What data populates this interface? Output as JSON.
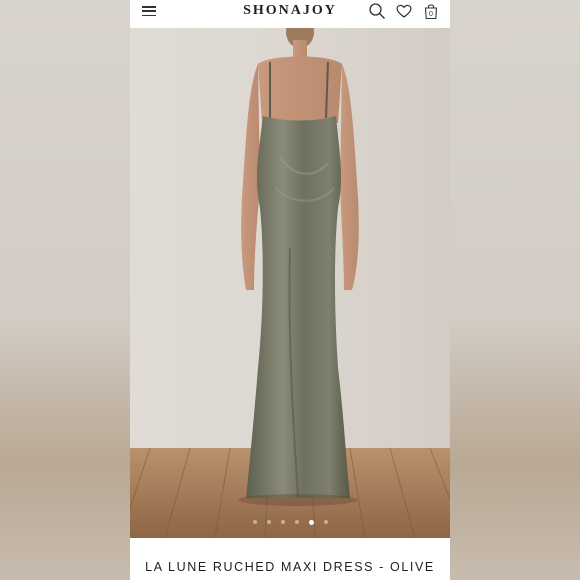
{
  "header": {
    "brand": "SHONAJOY",
    "bag_count": "0",
    "icons": [
      "hamburger-menu-icon",
      "search-icon",
      "heart-icon",
      "shopping-bag-icon"
    ]
  },
  "gallery": {
    "slide_count": 6,
    "active_index": 4
  },
  "product": {
    "title": "LA LUNE RUCHED MAXI DRESS - OLIVE"
  },
  "colors": {
    "dress": "#6e6f5e",
    "wall": "#d9d4cd",
    "floor": "#a57a55"
  }
}
